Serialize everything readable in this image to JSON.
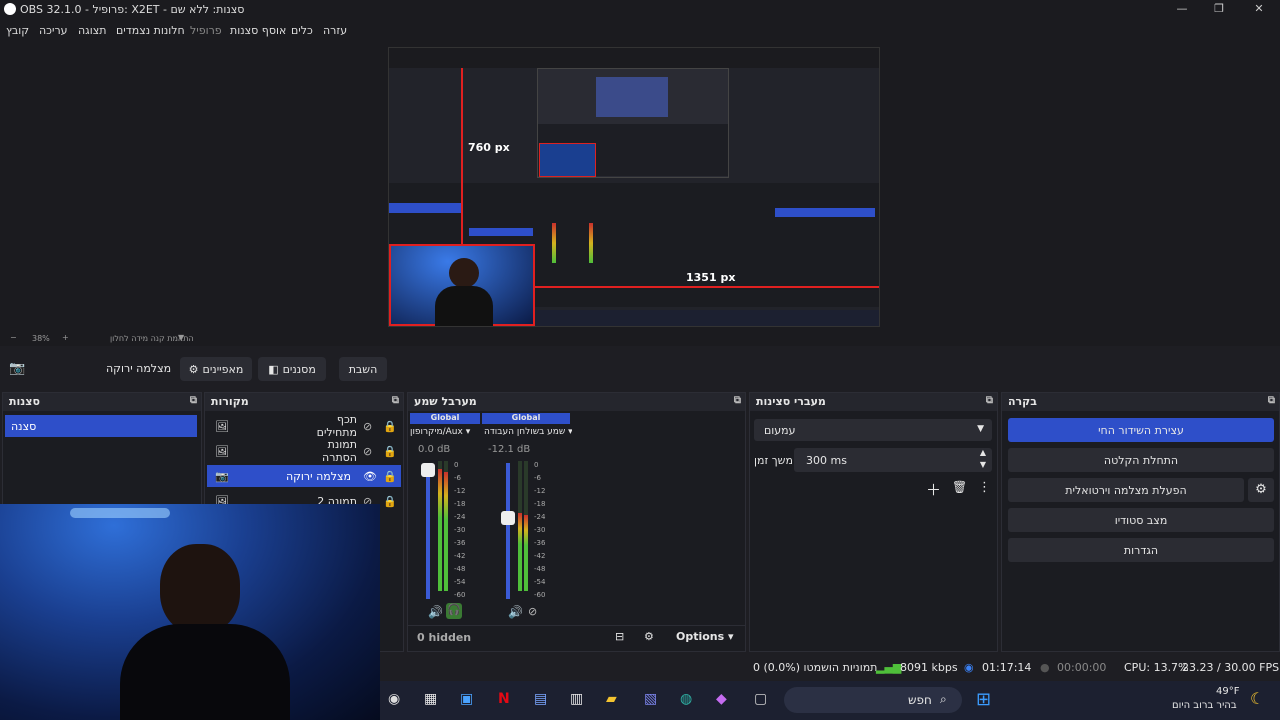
{
  "window": {
    "title": "OBS 32.1.0 - פרופיל: X2ET - סצנות: ללא שם"
  },
  "menu": [
    "קובץ",
    "עריכה",
    "תצוגה",
    "חלונות נצמדים",
    "פרופיל",
    "אוסף סצנות",
    "כלים",
    "עזרה"
  ],
  "preview": {
    "overlay_height": "760 px",
    "overlay_width": "1351 px",
    "zoom": "38%",
    "fit_label": "התאמת קנה מידה לחלון"
  },
  "toolbar": {
    "source_name": "מצלמה ירוקה",
    "properties": "מאפיינים",
    "filters": "מסננים",
    "deactivate": "השבת"
  },
  "scenes": {
    "title": "סצנות",
    "items": [
      "סצנה"
    ]
  },
  "sources": {
    "title": "מקורות",
    "items": [
      {
        "name": "תכף מתחילים"
      },
      {
        "name": "תמונת הסתרה"
      },
      {
        "name": "מצלמה ירוקה"
      },
      {
        "name": "תמונה 2"
      }
    ]
  },
  "mixer": {
    "title": "מערבל שמע",
    "channels": [
      {
        "tag": "Global",
        "name": "מיקרופון/Aux",
        "db": "0.0 dB",
        "level": 0.94
      },
      {
        "tag": "Global",
        "name": "שמע בשולחן העבודה",
        "db": "-12.1 dB",
        "level": 0.6
      }
    ],
    "scale": [
      "0",
      "-6",
      "-12",
      "-18",
      "-24",
      "-30",
      "-36",
      "-42",
      "-48",
      "-54",
      "-60"
    ],
    "hidden": "0 hidden",
    "options": "Options"
  },
  "transitions": {
    "title": "מעברי סצינות",
    "type": "עמעום",
    "duration_label": "משך זמן",
    "duration": "300 ms"
  },
  "controls": {
    "title": "בקרה",
    "stop_stream": "עצירת השידור החי",
    "start_record": "התחלת הקלטה",
    "virtual_cam": "הפעלת מצלמה וירטואלית",
    "studio_mode": "מצב סטודיו",
    "settings": "הגדרות"
  },
  "status": {
    "dropped": "0 תמוניות הושמטו (0.0%)",
    "kbps": "8091 kbps",
    "stream_time": "01:17:14",
    "rec_time": "00:00:00",
    "cpu": "CPU: 13.7%",
    "fps": "23.23 / 30.00 FPS"
  },
  "taskbar": {
    "search": "חפש",
    "weather_temp": "49°F",
    "weather_desc": "בהיר ברוב היום"
  },
  "colors": {
    "accent": "#2e4fc9",
    "meter_green": "#4fbf3a",
    "meter_yellow": "#d4b21e",
    "meter_red": "#c9302c"
  }
}
